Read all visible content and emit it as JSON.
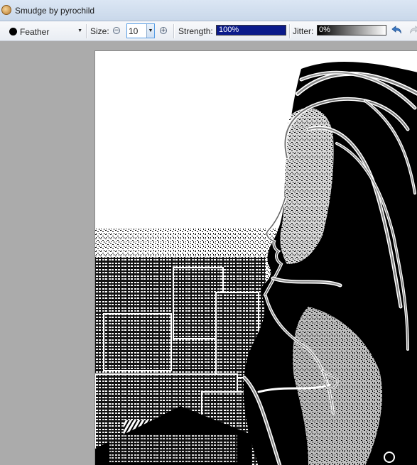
{
  "window": {
    "title": "Smudge by pyrochild"
  },
  "toolbar": {
    "brush": {
      "label": "Feather",
      "icon": "round-brush-icon"
    },
    "size": {
      "label": "Size:",
      "value": "10"
    },
    "strength": {
      "label": "Strength:",
      "value_text": "100%",
      "percent": 100,
      "fill_color": "#0a1a8a"
    },
    "jitter": {
      "label": "Jitter:",
      "value_text": "0%",
      "percent": 0
    },
    "undo_icon": "undo-icon",
    "redo_icon": "redo-icon"
  },
  "canvas": {
    "content": "high-contrast black and white artwork of a woman's profile over a city of apartment blocks"
  },
  "colors": {
    "workspace": "#ababab",
    "titlebar": "#dbe6f4",
    "accent_blue": "#3b78c4"
  }
}
